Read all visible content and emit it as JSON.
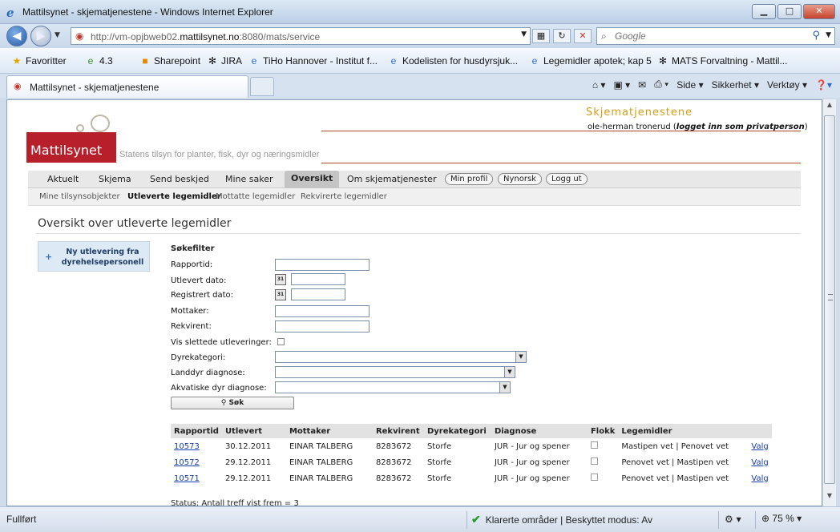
{
  "window": {
    "title": "Mattilsynet - skjematjenestene - Windows Internet Explorer",
    "buttons": {
      "minimize": "▁",
      "maximize": "□",
      "close": "✕"
    }
  },
  "addressbar": {
    "url_prefix": "http://vm-opjbweb02.",
    "url_domain": "mattilsynet.no",
    "url_suffix": ":8080/mats/service",
    "search_placeholder": "Google"
  },
  "favorites": {
    "label": "Favoritter",
    "items": [
      {
        "label": "4.3",
        "icon": "ie-page-icon"
      },
      {
        "label": "Sharepoint",
        "icon": "sharepoint-icon"
      },
      {
        "label": "JIRA",
        "icon": "jira-icon"
      },
      {
        "label": "TiHo Hannover - Institut f...",
        "icon": "ie-page-icon"
      },
      {
        "label": "Kodelisten for husdyrsjuk...",
        "icon": "ie-page-icon"
      },
      {
        "label": "Legemidler apotek; kap 5",
        "icon": "ie-page-icon"
      },
      {
        "label": "MATS Forvaltning - Mattil...",
        "icon": "jira-icon"
      }
    ]
  },
  "tab": {
    "label": "Mattilsynet - skjematjenestene"
  },
  "commandbar": {
    "side": "Side",
    "sikkerhet": "Sikkerhet",
    "verktoy": "Verktøy"
  },
  "header": {
    "brand": "Skjematjenestene",
    "user": "ole-herman tronerud",
    "user_status": "logget inn som privatperson",
    "logo_text": "Mattilsynet",
    "tagline": "Statens tilsyn for planter, fisk, dyr og næringsmidler"
  },
  "mainnav": {
    "items": [
      "Aktuelt",
      "Skjema",
      "Send beskjed",
      "Mine saker",
      "Oversikt",
      "Om skjematjenester"
    ],
    "active": "Oversikt",
    "pills": [
      "Min profil",
      "Nynorsk",
      "Logg ut"
    ]
  },
  "subnav": {
    "items": [
      "Mine tilsynsobjekter",
      "Utleverte legemidler",
      "Mottatte legemidler",
      "Rekvirerte legemidler"
    ],
    "active": "Utleverte legemidler"
  },
  "page": {
    "title": "Oversikt over utleverte legemidler",
    "side_button": "Ny utlevering fra dyrehelsepersonell"
  },
  "filter": {
    "title": "Søkefilter",
    "rapportid": "Rapportid:",
    "utlevert_dato": "Utlevert dato:",
    "registrert_dato": "Registrert dato:",
    "mottaker": "Mottaker:",
    "rekvirent": "Rekvirent:",
    "vis_slettede": "Vis slettede utleveringer:",
    "dyrekategori": "Dyrekategori:",
    "landdyr": "Landdyr diagnose:",
    "akvatiske": "Akvatiske dyr diagnose:",
    "sok_button": "Søk",
    "calendar_label": "31"
  },
  "table": {
    "headers": [
      "Rapportid",
      "Utlevert",
      "Mottaker",
      "Rekvirent",
      "Dyrekategori",
      "Diagnose",
      "Flokk",
      "Legemidler",
      ""
    ],
    "rows": [
      {
        "id": "10573",
        "utlevert": "30.12.2011",
        "mottaker": "EINAR TALBERG",
        "rekvirent": "8283672",
        "dyrekategori": "Storfe",
        "diagnose": "JUR - Jur og spener",
        "legemidler": "Mastipen vet | Penovet vet",
        "valg": "Valg"
      },
      {
        "id": "10572",
        "utlevert": "29.12.2011",
        "mottaker": "EINAR TALBERG",
        "rekvirent": "8283672",
        "dyrekategori": "Storfe",
        "diagnose": "JUR - Jur og spener",
        "legemidler": "Penovet vet | Mastipen vet",
        "valg": "Valg"
      },
      {
        "id": "10571",
        "utlevert": "29.12.2011",
        "mottaker": "EINAR TALBERG",
        "rekvirent": "8283672",
        "dyrekategori": "Storfe",
        "diagnose": "JUR - Jur og spener",
        "legemidler": "Penovet vet | Mastipen vet",
        "valg": "Valg"
      }
    ]
  },
  "status": "Status: Antall treff vist frem = 3",
  "statusbar": {
    "left": "Fullført",
    "zone": "Klarerte områder | Beskyttet modus: Av",
    "zoom": "75 %"
  }
}
